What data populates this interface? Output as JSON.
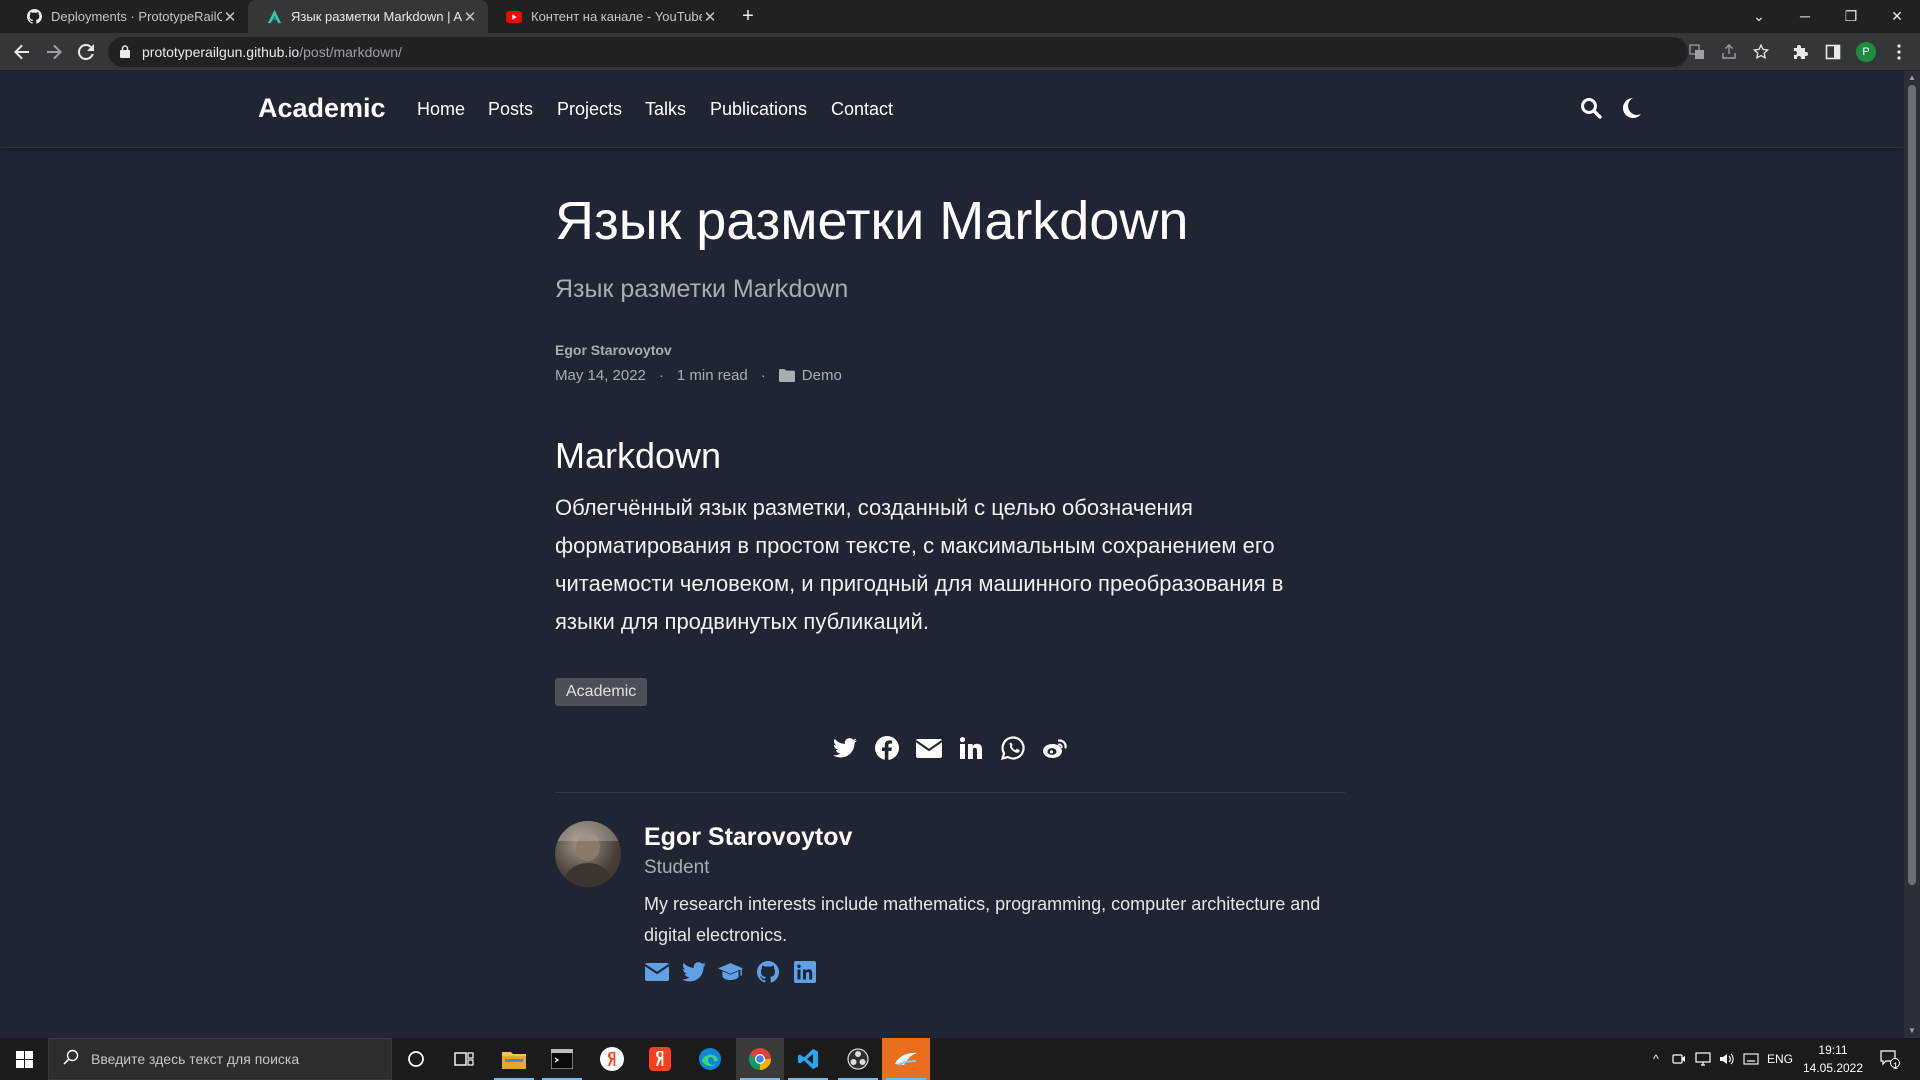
{
  "browser": {
    "tabs": [
      {
        "title": "Deployments · PrototypeRailGun",
        "favicon": "github-icon"
      },
      {
        "title": "Язык разметки Markdown | Academic",
        "favicon": "academic-icon"
      },
      {
        "title": "Контент на канале - YouTube Studio",
        "favicon": "youtube-icon"
      }
    ],
    "url_host": "prototyperailgun.github.io",
    "url_path": "/post/markdown/",
    "profile_initial": "P"
  },
  "site": {
    "brand": "Academic",
    "menu": [
      "Home",
      "Posts",
      "Projects",
      "Talks",
      "Publications",
      "Contact"
    ]
  },
  "post": {
    "title": "Язык разметки Markdown",
    "subtitle": "Язык разметки Markdown",
    "author": "Egor Starovoytov",
    "date": "May 14, 2022",
    "separator": "·",
    "read_time": "1 min read",
    "category": "Demo",
    "heading": "Markdown",
    "body": "Облегчённый язык разметки, созданный с целью обозначения форматирования в простом тексте, с максимальным сохранением его читаемости человеком, и пригодный для машинного преобразования в языки для продвинутых публикаций.",
    "tag": "Academic"
  },
  "share_icons": [
    "twitter-icon",
    "facebook-icon",
    "email-icon",
    "linkedin-icon",
    "whatsapp-icon",
    "weibo-icon"
  ],
  "author_card": {
    "name": "Egor Starovoytov",
    "role": "Student",
    "bio": "My research interests include mathematics, programming, computer architecture and digital electronics.",
    "links": [
      "email-icon",
      "twitter-icon",
      "graduation-cap-icon",
      "github-icon",
      "linkedin-icon"
    ]
  },
  "taskbar": {
    "search_placeholder": "Введите здесь текст для поиска",
    "language": "ENG",
    "time": "19:11",
    "date": "14.05.2022",
    "notification_count": "1"
  },
  "colors": {
    "page_bg": "#1f2532",
    "accent_link": "#5fa0e6",
    "tag_bg": "#4a4f58"
  }
}
